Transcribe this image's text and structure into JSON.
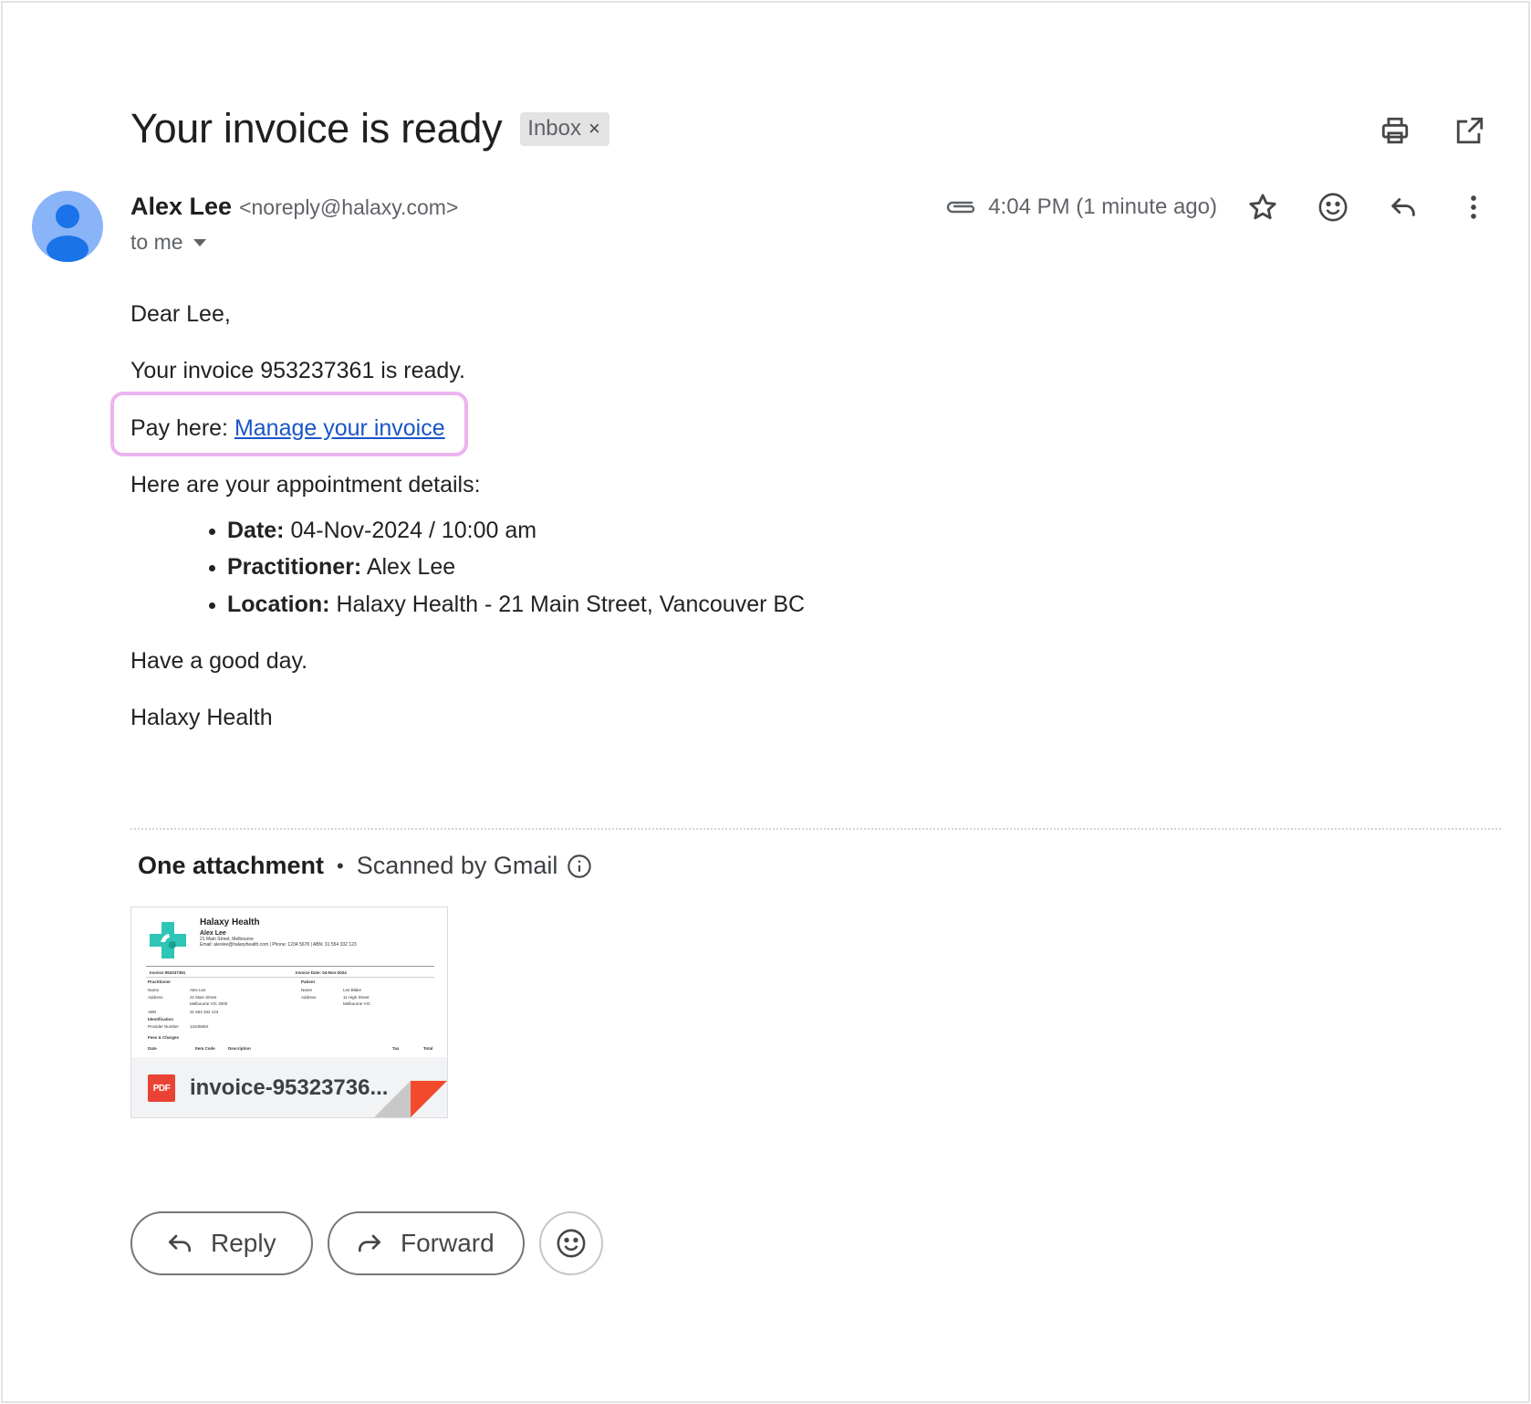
{
  "email": {
    "subject": "Your invoice is ready",
    "label": "Inbox",
    "label_close": "×",
    "sender_name": "Alex Lee",
    "sender_email": "<noreply@halaxy.com>",
    "recipient": "to me",
    "timestamp": "4:04 PM (1 minute ago)"
  },
  "body": {
    "greeting": "Dear Lee,",
    "invoice_line": "Your invoice 953237361 is ready.",
    "pay_prefix": "Pay here: ",
    "pay_link": "Manage your invoice",
    "details_intro": "Here are your appointment details:",
    "details": [
      {
        "label": "Date:",
        "value": " 04-Nov-2024 / 10:00 am"
      },
      {
        "label": "Practitioner:",
        "value": " Alex Lee"
      },
      {
        "label": "Location:",
        "value": " Halaxy Health - 21 Main Street, Vancouver BC"
      }
    ],
    "closing": "Have a good day.",
    "signature": "Halaxy Health"
  },
  "attachments": {
    "count_label": "One attachment",
    "separator": "•",
    "scanned_label": "Scanned by Gmail",
    "file_name": "invoice-95323736...",
    "file_type": "PDF",
    "preview": {
      "org": "Halaxy Health",
      "name": "Alex Lee",
      "address": "21 Main Street, Melbourne",
      "contact": "Email: alexlee@halaxyhealth.com | Phone: 1234 5678 | ABN: 31 554 332 123",
      "invoice_no": "Invoice 953237361",
      "invoice_date": "Invoice Date: 04-Nov-2024",
      "practitioner_head": "Practitioner",
      "patient_head": "Patient",
      "name_label": "Name",
      "name_value": "Alex Lee",
      "address_label": "Address",
      "address_value_1": "21 Main Street",
      "address_value_2": "Melbourne VIC 3000",
      "abn_label": "ABN",
      "abn_value": "31 554 332 123",
      "patient_name": "Lee Blake",
      "patient_address_1": "11 High Street",
      "patient_address_2": "Melbourne VIC",
      "identification_head": "Identification",
      "provider_label": "Provider Number",
      "provider_value": "1234568X",
      "fees_head": "Fees & Charges",
      "col_date": "Date",
      "col_code": "Item Code",
      "col_desc": "Description",
      "col_tax": "Tax",
      "col_total": "Total"
    }
  },
  "actions": {
    "reply": "Reply",
    "forward": "Forward"
  },
  "colors": {
    "link": "#1a55c9",
    "highlight": "#ebb4ef",
    "avatar": "#8ab4f8",
    "avatar_figure": "#1a73e8",
    "pdf_red": "#ea4335",
    "logo_teal": "#2ec4b6"
  }
}
